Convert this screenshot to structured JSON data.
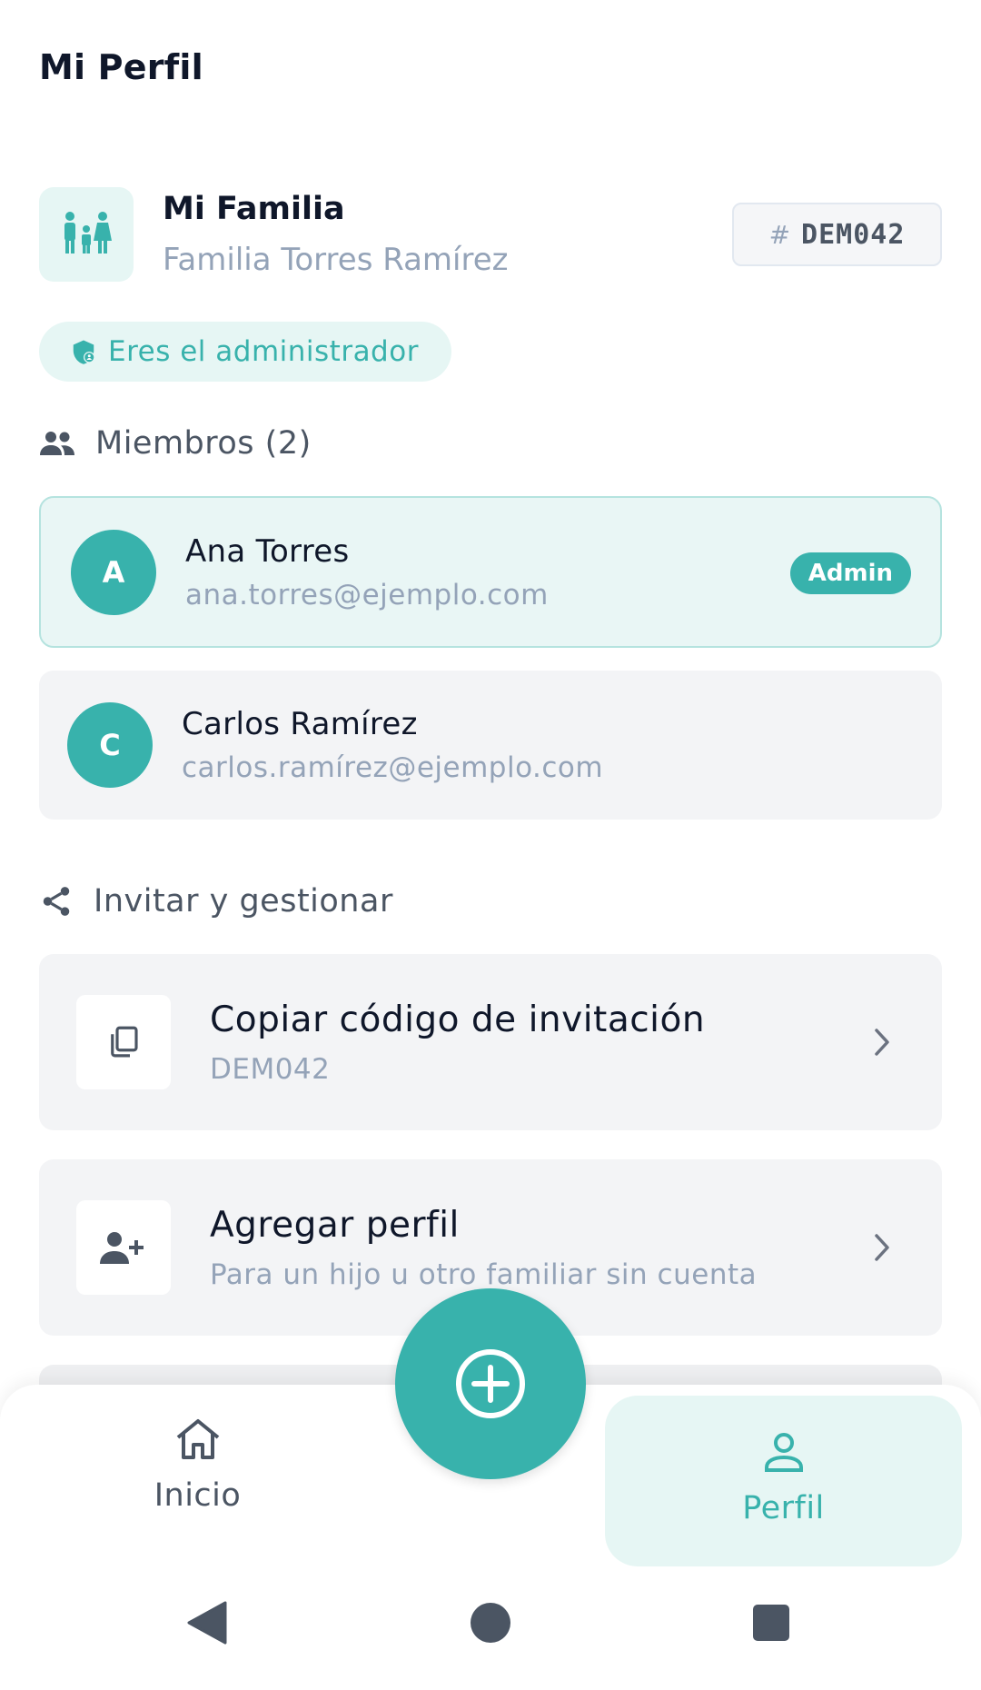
{
  "header": {
    "title": "Mi Perfil"
  },
  "family": {
    "label": "Mi Familia",
    "name": "Familia Torres Ramírez",
    "code_hash": "#",
    "code": "DEM042",
    "admin_badge": "Eres el administrador",
    "icon": "family-icon"
  },
  "members_section": {
    "title": "Miembros (2)",
    "icon": "people-icon",
    "members": [
      {
        "initial": "A",
        "name": "Ana Torres",
        "email": "ana.torres@ejemplo.com",
        "role": "Admin"
      },
      {
        "initial": "C",
        "name": "Carlos Ramírez",
        "email": "carlos.ramírez@ejemplo.com"
      }
    ]
  },
  "invite_section": {
    "title": "Invitar y gestionar",
    "icon": "share-icon",
    "actions": [
      {
        "title": "Copiar código de invitación",
        "subtitle": "DEM042",
        "icon": "copy-icon"
      },
      {
        "title": "Agregar perfil",
        "subtitle": "Para un hijo u otro familiar sin cuenta",
        "icon": "add-person-icon"
      }
    ]
  },
  "bottom_nav": {
    "items": [
      {
        "label": "Inicio",
        "icon": "home-icon",
        "active": false
      },
      {
        "label": "Perfil",
        "icon": "person-icon",
        "active": true
      }
    ],
    "fab_icon": "add-circle-icon"
  },
  "colors": {
    "accent": "#38b2ac",
    "accent_light": "#e6f6f4",
    "text": "#0f172a",
    "muted": "#94a3b8"
  }
}
